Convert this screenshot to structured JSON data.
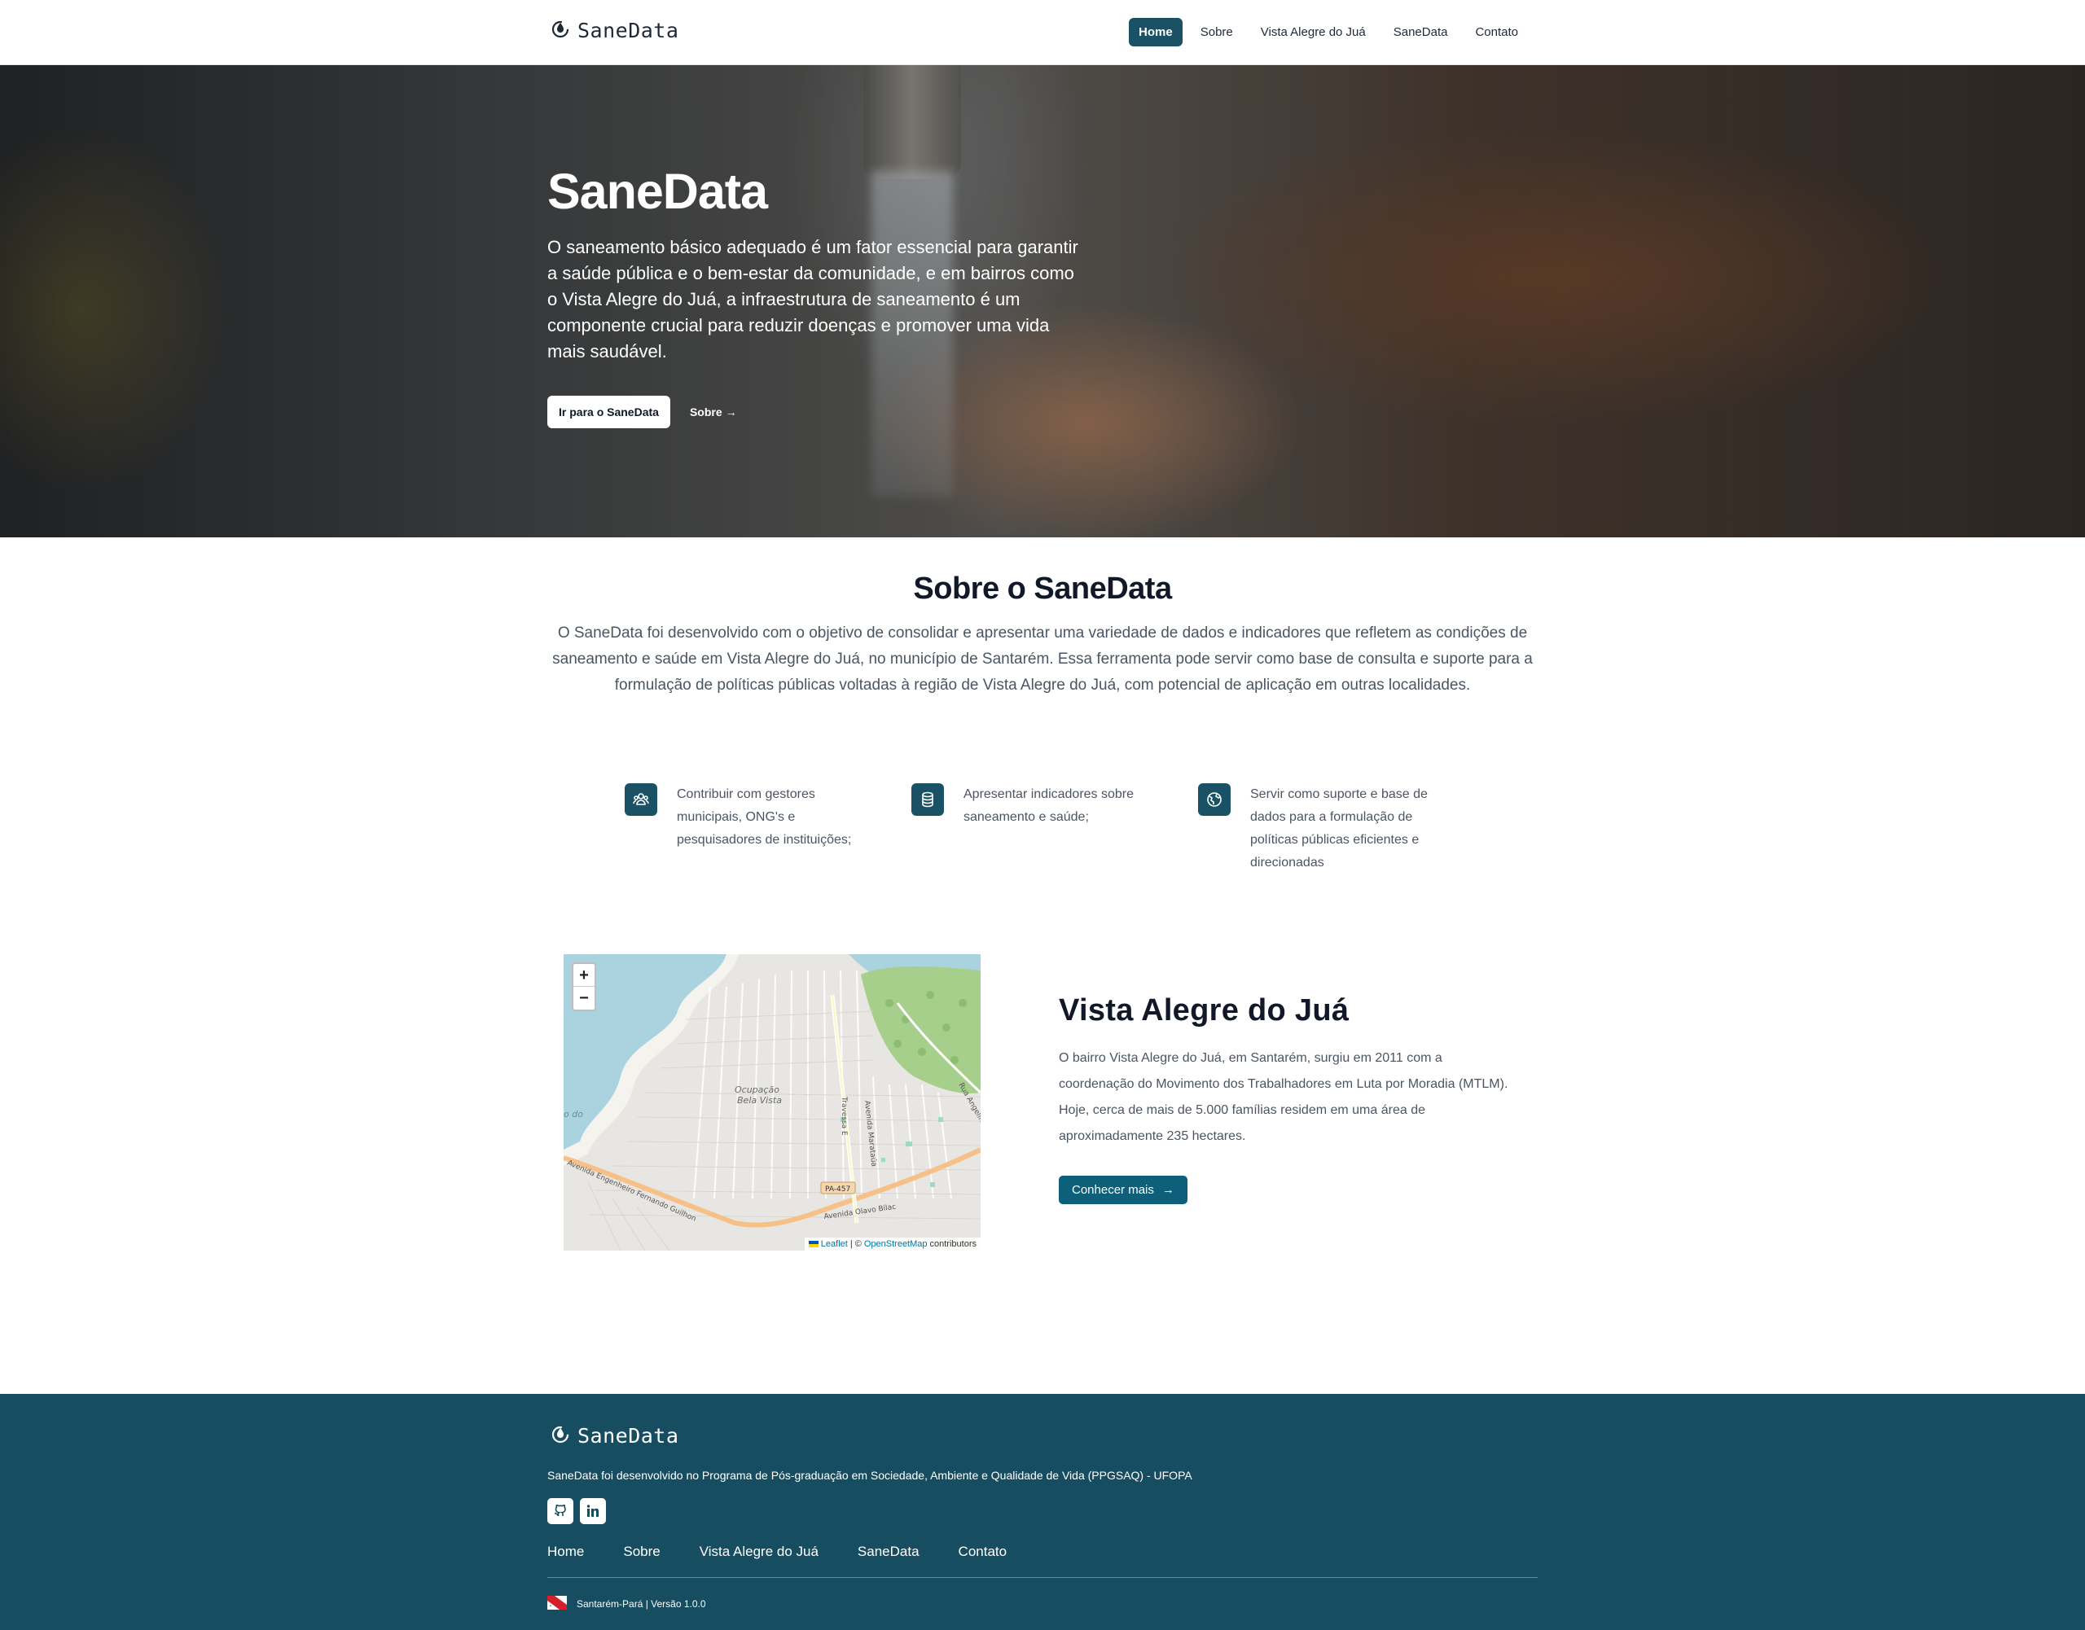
{
  "brand": {
    "name": "SaneData",
    "icon": "droplet-recycle-icon"
  },
  "nav": {
    "items": [
      {
        "label": "Home",
        "active": true
      },
      {
        "label": "Sobre",
        "active": false
      },
      {
        "label": "Vista Alegre do Juá",
        "active": false
      },
      {
        "label": "SaneData",
        "active": false
      },
      {
        "label": "Contato",
        "active": false
      }
    ]
  },
  "hero": {
    "title": "SaneData",
    "text": "O saneamento básico adequado é um fator essencial para garantir a saúde pública e o bem-estar da comunidade, e em bairros como o Vista Alegre do Juá, a infraestrutura de saneamento é um componente crucial para reduzir doenças e promover uma vida mais saudável.",
    "primary_button": "Ir para o SaneData",
    "secondary_button": "Sobre",
    "secondary_arrow": "→"
  },
  "about": {
    "title": "Sobre o SaneData",
    "text": "O SaneData foi desenvolvido com o objetivo de consolidar e apresentar uma variedade de dados e indicadores que refletem as condições de saneamento e saúde em Vista Alegre do Juá, no município de Santarém. Essa ferramenta pode servir como base de consulta e suporte para a formulação de políticas públicas voltadas à região de Vista Alegre do Juá, com potencial de aplicação em outras localidades.",
    "features": [
      {
        "icon": "people-icon",
        "text": "Contribuir com gestores municipais, ONG's e pesquisadores de instituições;"
      },
      {
        "icon": "database-icon",
        "text": "Apresentar indicadores sobre saneamento e saúde;"
      },
      {
        "icon": "globe-icon",
        "text": "Servir como suporte e base de dados para a formulação de políticas públicas eficientes e direcionadas"
      }
    ]
  },
  "map": {
    "zoom_in": "+",
    "zoom_out": "−",
    "labels": {
      "ocupacao": "Ocupação",
      "bela_vista": "Bela Vista",
      "travessa": "Travessa E",
      "avenida_marataua": "Avenida Marataúa",
      "rua": "Rua Angelim",
      "pa": "PA-457",
      "olavo": "Avenida Olavo Bilac",
      "eng": "Avenida Engenheiro Fernando Guilhon",
      "edge": "o do"
    },
    "attribution": {
      "leaflet": "Leaflet",
      "sep": "| ©",
      "osm": "OpenStreetMap",
      "contrib": "contributors"
    }
  },
  "vista": {
    "title": "Vista Alegre do Juá",
    "text": "O bairro Vista Alegre do Juá, em Santarém, surgiu em 2011 com a coordenação do Movimento dos Trabalhadores em Luta por Moradia (MTLM). Hoje, cerca de mais de 5.000 famílias residem em uma área de aproximadamente 235 hectares.",
    "button": "Conhecer mais",
    "button_arrow": "→"
  },
  "footer": {
    "brand": "SaneData",
    "description": "SaneData foi desenvolvido no Programa de Pós-graduação em Sociedade, Ambiente e Qualidade de Vida (PPGSAQ) - UFOPA",
    "social": [
      {
        "icon": "github-icon"
      },
      {
        "icon": "linkedin-icon"
      }
    ],
    "links": [
      "Home",
      "Sobre",
      "Vista Alegre do Juá",
      "SaneData",
      "Contato"
    ],
    "bottom_text": "Santarém-Pará | Versão 1.0.0",
    "flag_icon": "para-flag-icon"
  },
  "colors": {
    "primary": "#1a5164",
    "button": "#0e5f79",
    "footer": "#174d60"
  }
}
